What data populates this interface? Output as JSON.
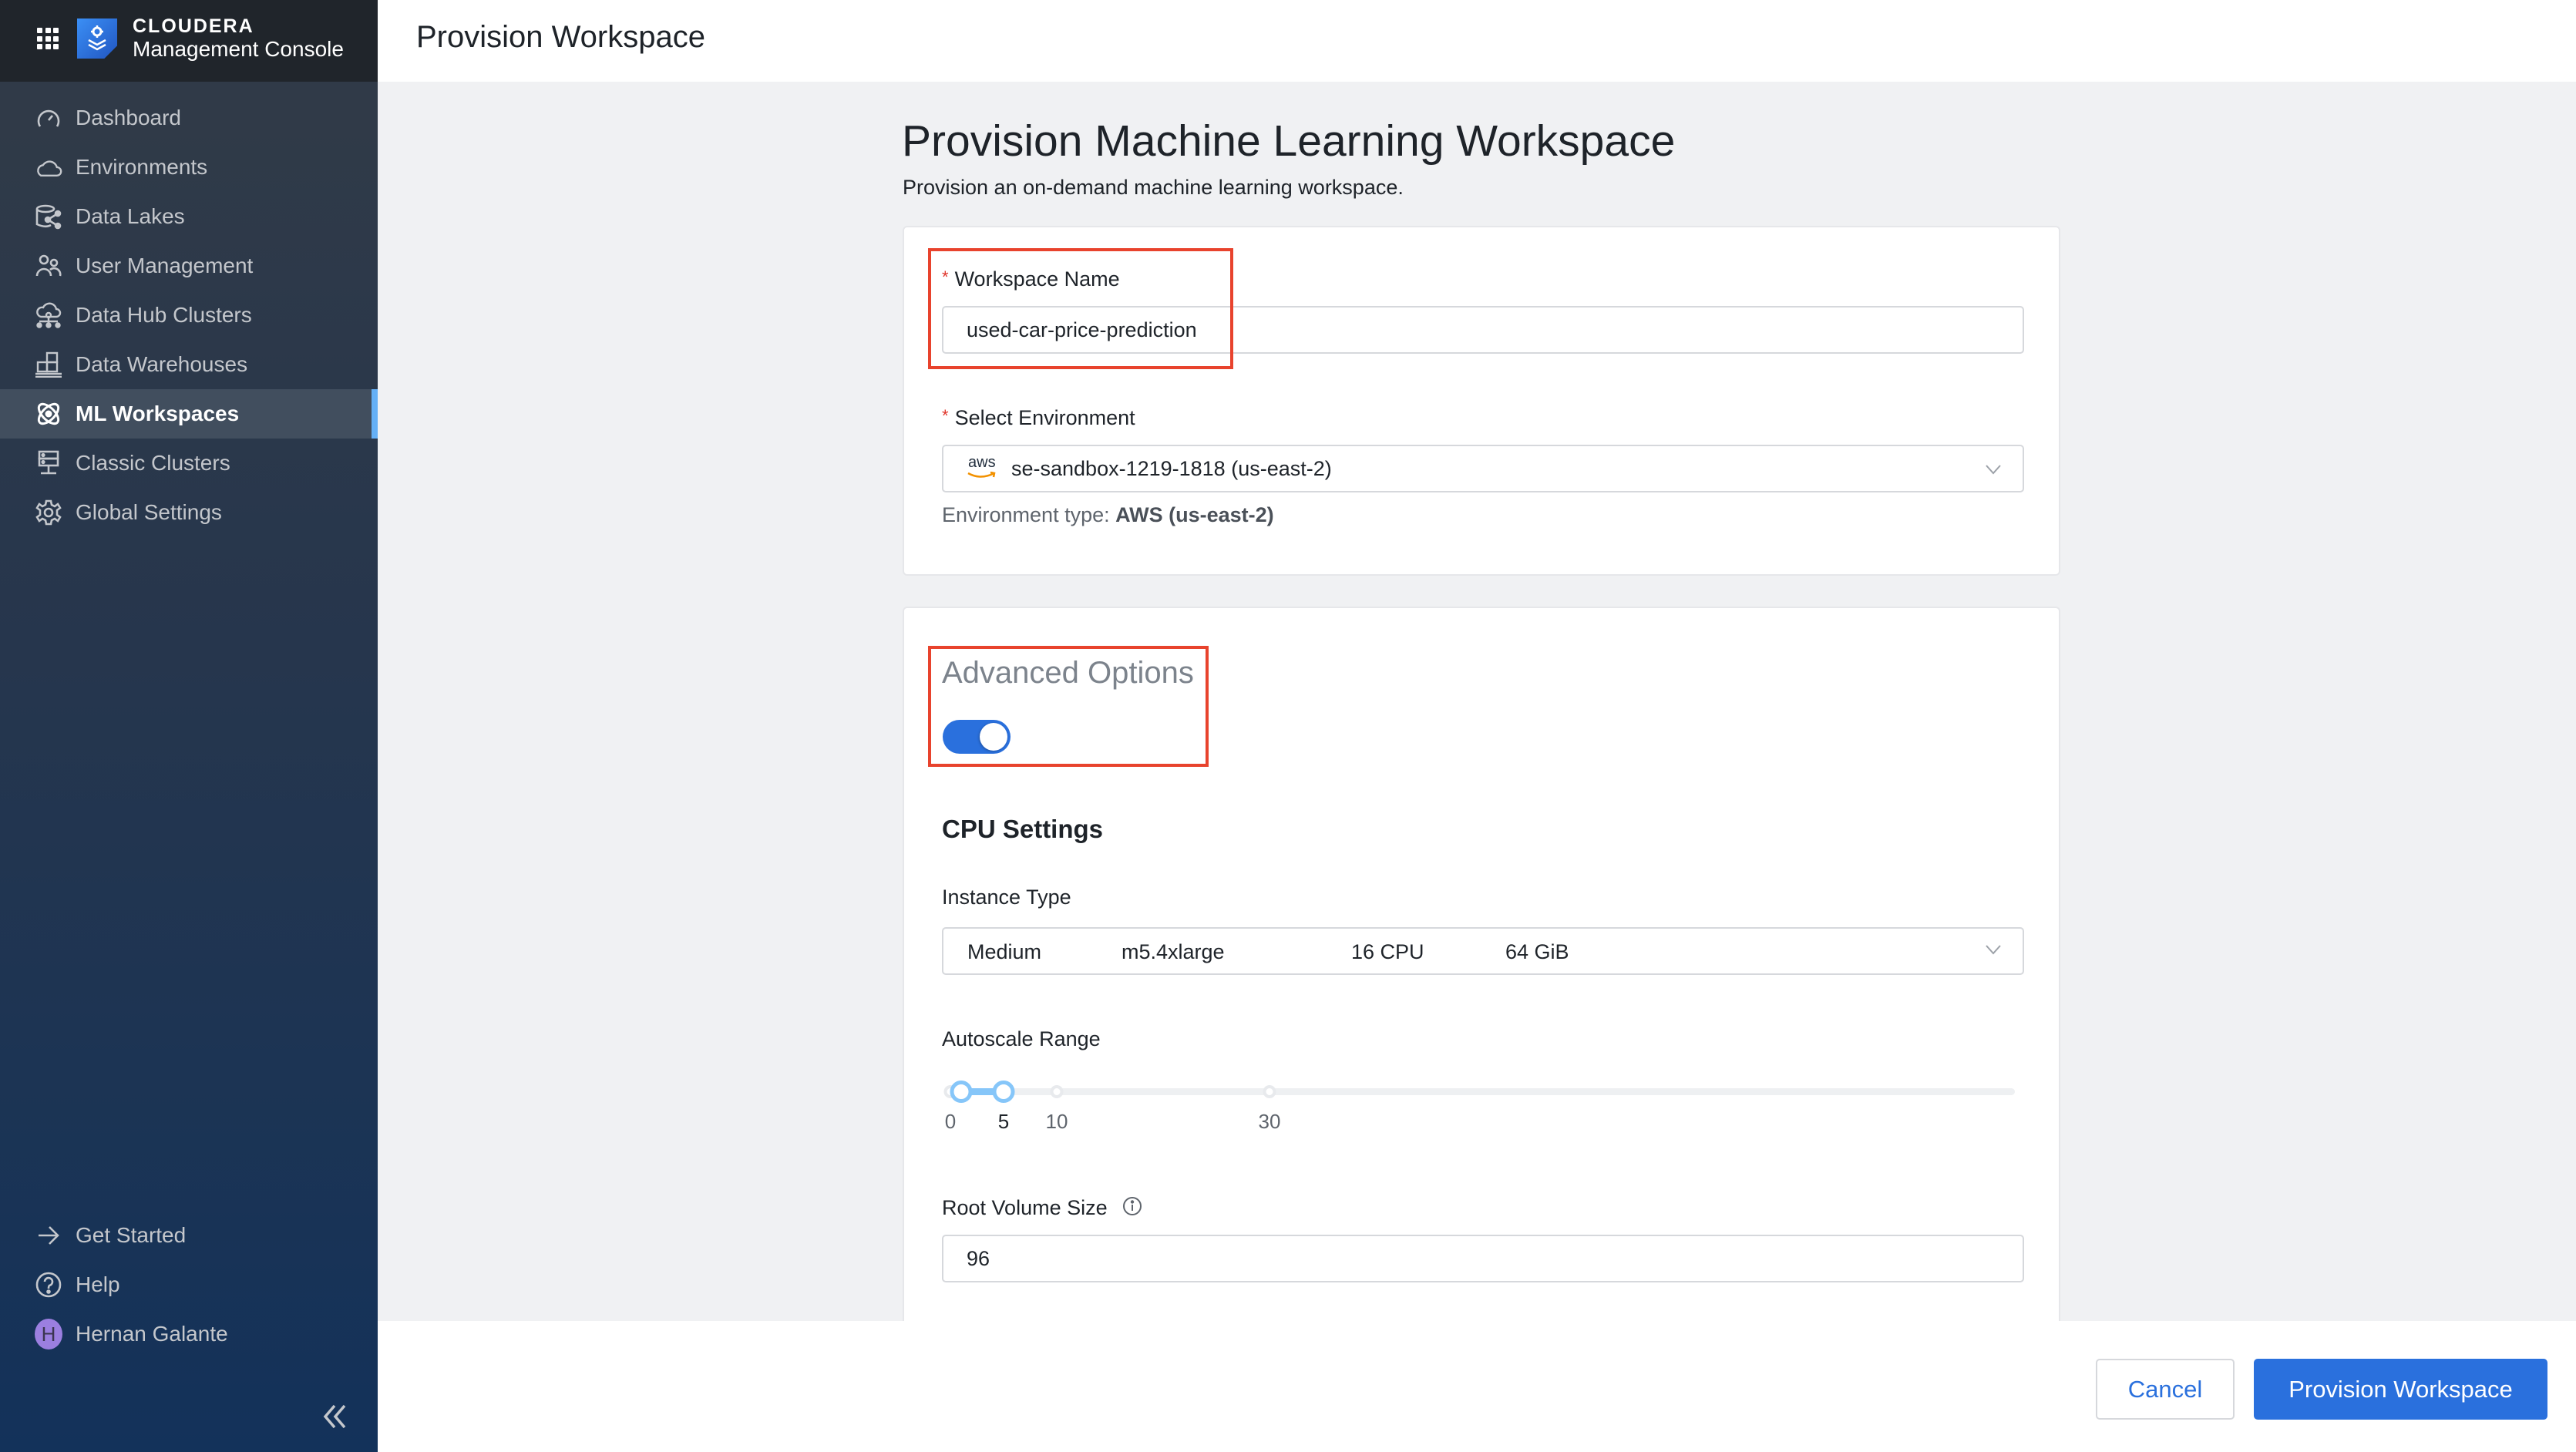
{
  "brand": {
    "company": "CLOUDERA",
    "product": "Management Console"
  },
  "sidebar": {
    "items": [
      {
        "label": "Dashboard",
        "icon": "gauge-icon"
      },
      {
        "label": "Environments",
        "icon": "cloud-icon"
      },
      {
        "label": "Data Lakes",
        "icon": "data-lake-icon"
      },
      {
        "label": "User Management",
        "icon": "users-icon"
      },
      {
        "label": "Data Hub Clusters",
        "icon": "cloud-network-icon"
      },
      {
        "label": "Data Warehouses",
        "icon": "warehouse-icon"
      },
      {
        "label": "ML Workspaces",
        "icon": "atom-icon",
        "active": true
      },
      {
        "label": "Classic Clusters",
        "icon": "server-icon"
      },
      {
        "label": "Global Settings",
        "icon": "gear-icon"
      }
    ],
    "bottom": [
      {
        "label": "Get Started",
        "icon": "arrow-right-icon"
      },
      {
        "label": "Help",
        "icon": "help-icon"
      },
      {
        "label": "Hernan Galante",
        "avatar_initial": "H"
      }
    ],
    "accent_color": "#65b0f6"
  },
  "header": {
    "title": "Provision Workspace"
  },
  "main": {
    "title": "Provision Machine Learning Workspace",
    "subtitle": "Provision an on-demand machine learning workspace.",
    "workspace_name": {
      "required_mark": "*",
      "label": "Workspace Name",
      "value": "used-car-price-prediction"
    },
    "environment": {
      "required_mark": "*",
      "label": "Select Environment",
      "provider_logo": "aws",
      "value": "se-sandbox-1219-1818 (us-east-2)",
      "type_label": "Environment type:",
      "type_value": "AWS (us-east-2)"
    },
    "advanced": {
      "title": "Advanced Options",
      "enabled": true
    },
    "cpu_settings": {
      "title": "CPU Settings",
      "instance_type": {
        "label": "Instance Type",
        "size": "Medium",
        "name": "m5.4xlarge",
        "cpu": "16 CPU",
        "memory": "64 GiB"
      },
      "autoscale": {
        "label": "Autoscale Range",
        "min_value": 1,
        "max_value": 5,
        "range_max": 100,
        "marks": [
          {
            "value": 0,
            "label": "0"
          },
          {
            "value": 5,
            "label": "5"
          },
          {
            "value": 10,
            "label": "10"
          },
          {
            "value": 30,
            "label": "30"
          }
        ]
      },
      "root_volume": {
        "label": "Root Volume Size",
        "value": "96"
      }
    }
  },
  "footer": {
    "cancel_label": "Cancel",
    "submit_label": "Provision Workspace"
  },
  "colors": {
    "primary": "#2a70dd",
    "highlight": "#e8432d",
    "required": "#e0352b"
  }
}
